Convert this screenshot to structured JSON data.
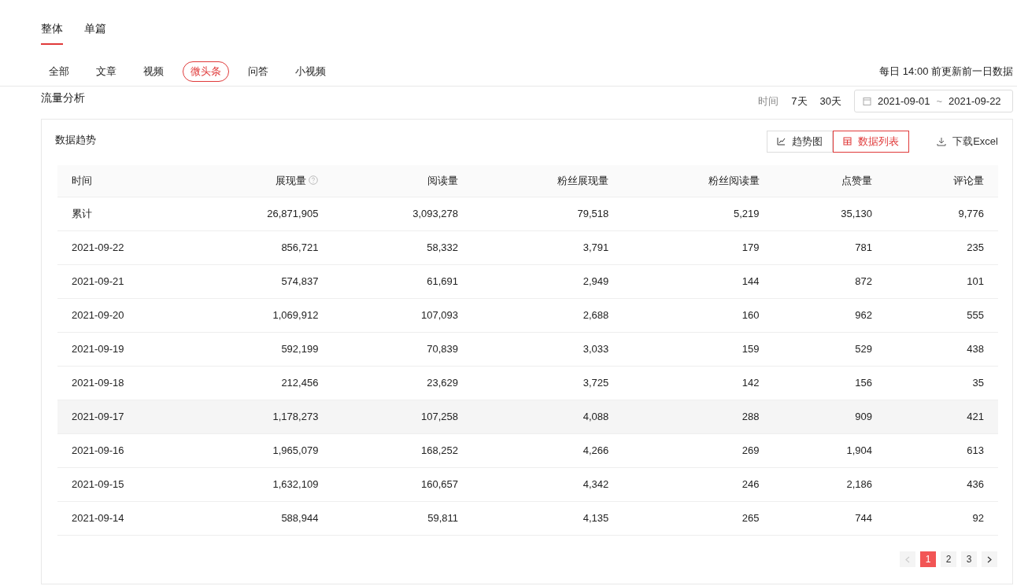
{
  "scope_tabs": [
    {
      "label": "整体",
      "selected": true
    },
    {
      "label": "单篇",
      "selected": false
    }
  ],
  "content_tabs": [
    {
      "label": "全部",
      "selected": false
    },
    {
      "label": "文章",
      "selected": false
    },
    {
      "label": "视频",
      "selected": false
    },
    {
      "label": "微头条",
      "selected": true
    },
    {
      "label": "问答",
      "selected": false
    },
    {
      "label": "小视频",
      "selected": false
    }
  ],
  "update_note": "每日 14:00 前更新前一日数据",
  "section_title": "流量分析",
  "time_filter": {
    "label": "时间",
    "options": [
      {
        "label": "7天",
        "selected": false
      },
      {
        "label": "30天",
        "selected": false
      }
    ],
    "date_range": {
      "start": "2021-09-01",
      "separator": "~",
      "end": "2021-09-22"
    }
  },
  "card": {
    "title": "数据趋势",
    "view_toggle": [
      {
        "label": "趋势图",
        "kind": "chart",
        "selected": false
      },
      {
        "label": "数据列表",
        "kind": "table",
        "selected": true
      }
    ],
    "download": "下载Excel",
    "table": {
      "columns": [
        {
          "label": "时间",
          "help": false
        },
        {
          "label": "展现量",
          "help": true
        },
        {
          "label": "阅读量",
          "help": false
        },
        {
          "label": "粉丝展现量",
          "help": false
        },
        {
          "label": "粉丝阅读量",
          "help": false
        },
        {
          "label": "点赞量",
          "help": false
        },
        {
          "label": "评论量",
          "help": false
        }
      ],
      "rows": [
        {
          "cells": [
            "累计",
            "26,871,905",
            "3,093,278",
            "79,518",
            "5,219",
            "35,130",
            "9,776"
          ],
          "highlighted": false
        },
        {
          "cells": [
            "2021-09-22",
            "856,721",
            "58,332",
            "3,791",
            "179",
            "781",
            "235"
          ],
          "highlighted": false
        },
        {
          "cells": [
            "2021-09-21",
            "574,837",
            "61,691",
            "2,949",
            "144",
            "872",
            "101"
          ],
          "highlighted": false
        },
        {
          "cells": [
            "2021-09-20",
            "1,069,912",
            "107,093",
            "2,688",
            "160",
            "962",
            "555"
          ],
          "highlighted": false
        },
        {
          "cells": [
            "2021-09-19",
            "592,199",
            "70,839",
            "3,033",
            "159",
            "529",
            "438"
          ],
          "highlighted": false
        },
        {
          "cells": [
            "2021-09-18",
            "212,456",
            "23,629",
            "3,725",
            "142",
            "156",
            "35"
          ],
          "highlighted": false
        },
        {
          "cells": [
            "2021-09-17",
            "1,178,273",
            "107,258",
            "4,088",
            "288",
            "909",
            "421"
          ],
          "highlighted": true
        },
        {
          "cells": [
            "2021-09-16",
            "1,965,079",
            "168,252",
            "4,266",
            "269",
            "1,904",
            "613"
          ],
          "highlighted": false
        },
        {
          "cells": [
            "2021-09-15",
            "1,632,109",
            "160,657",
            "4,342",
            "246",
            "2,186",
            "436"
          ],
          "highlighted": false
        },
        {
          "cells": [
            "2021-09-14",
            "588,944",
            "59,811",
            "4,135",
            "265",
            "744",
            "92"
          ],
          "highlighted": false
        }
      ]
    },
    "pagination": {
      "prev_disabled": true,
      "pages": [
        {
          "label": "1",
          "selected": true
        },
        {
          "label": "2",
          "selected": false
        },
        {
          "label": "3",
          "selected": false
        }
      ],
      "next_disabled": false
    }
  }
}
